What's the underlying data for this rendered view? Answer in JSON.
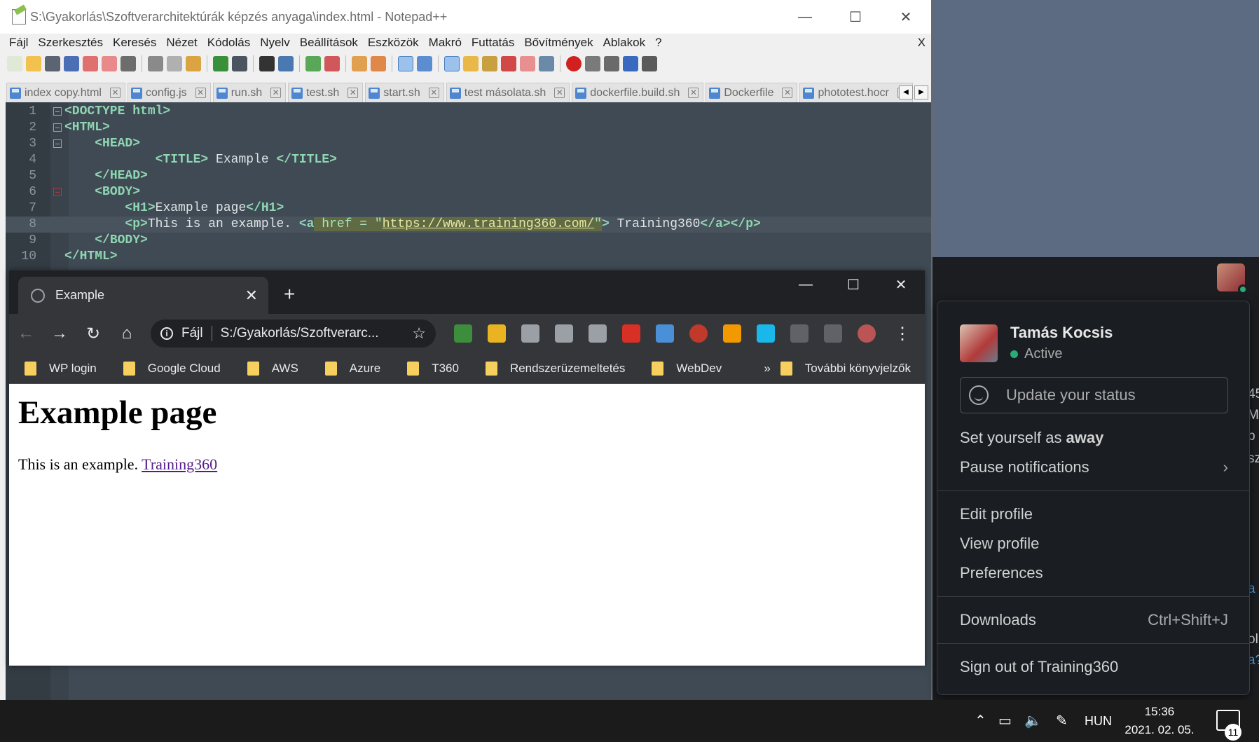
{
  "notepad": {
    "title": "S:\\Gyakorlás\\Szoftverarchitektúrák képzés anyaga\\index.html - Notepad++",
    "menu": [
      "Fájl",
      "Szerkesztés",
      "Keresés",
      "Nézet",
      "Kódolás",
      "Nyelv",
      "Beállítások",
      "Eszközök",
      "Makró",
      "Futtatás",
      "Bővítmények",
      "Ablakok",
      "?"
    ],
    "menu_close": "X",
    "tabs": [
      "index copy.html",
      "config.js",
      "run.sh",
      "test.sh",
      "start.sh",
      "test másolata.sh",
      "dockerfile.build.sh",
      "Dockerfile",
      "phototest.hocr"
    ],
    "line_numbers": [
      "1",
      "2",
      "3",
      "4",
      "5",
      "6",
      "7",
      "8",
      "9",
      "10"
    ],
    "code": {
      "l1": "<DOCTYPE html>",
      "l2": "<HTML>",
      "l3": "<HEAD>",
      "l4_open": "<TITLE>",
      "l4_text": " Example ",
      "l4_close": "</TITLE>",
      "l5": "</HEAD>",
      "l6": "<BODY>",
      "l7_open": "<H1>",
      "l7_text": "Example page",
      "l7_close": "</H1>",
      "l8_p": "<p>",
      "l8_text": "This is an example. ",
      "l8_a": "<a",
      "l8_href": " href = \"",
      "l8_url": "https://www.training360.com/",
      "l8_quote": "\"",
      "l8_gt": ">",
      "l8_link": " Training360",
      "l8_close": "</a></p>",
      "l9": "</BODY>",
      "l10": "</HTML>"
    }
  },
  "chrome": {
    "tab_title": "Example",
    "omnibox_scheme": "Fájl",
    "omnibox_url": "S:/Gyakorlás/Szoftverarc...",
    "bookmarks": [
      "WP login",
      "Google Cloud",
      "AWS",
      "Azure",
      "T360",
      "Rendszerüzemeltetés",
      "WebDev"
    ],
    "bookmarks_more": "»",
    "other_bookmarks": "További könyvjelzők",
    "extensions": [
      "#3c8d3c",
      "#e9b321",
      "#9aa0a6",
      "#9aa0a6",
      "#9aa0a6",
      "#d93025",
      "#4a90d9",
      "#c0392b",
      "#f29900",
      "#1ab7ea",
      "#e8eaed",
      "#e8eaed",
      "#b55"
    ],
    "page": {
      "h1": "Example page",
      "text": "This is an example. ",
      "link": "Training360"
    }
  },
  "slack": {
    "name": "Tamás Kocsis",
    "status": "Active",
    "status_color": "#2bac76",
    "update_status": "Update your status",
    "set_away_prefix": "Set yourself as",
    "set_away_bold": "away",
    "pause_notifications": "Pause notifications",
    "edit_profile": "Edit profile",
    "view_profile": "View profile",
    "preferences": "Preferences",
    "downloads": "Downloads",
    "downloads_shortcut": "Ctrl+Shift+J",
    "sign_out": "Sign out of Training360",
    "edge_chars": [
      "45",
      "M",
      "b",
      "sz",
      "a",
      "ol",
      "a?"
    ]
  },
  "taskbar": {
    "language": "HUN",
    "time": "15:36",
    "date": "2021. 02. 05.",
    "notifications": "11"
  }
}
